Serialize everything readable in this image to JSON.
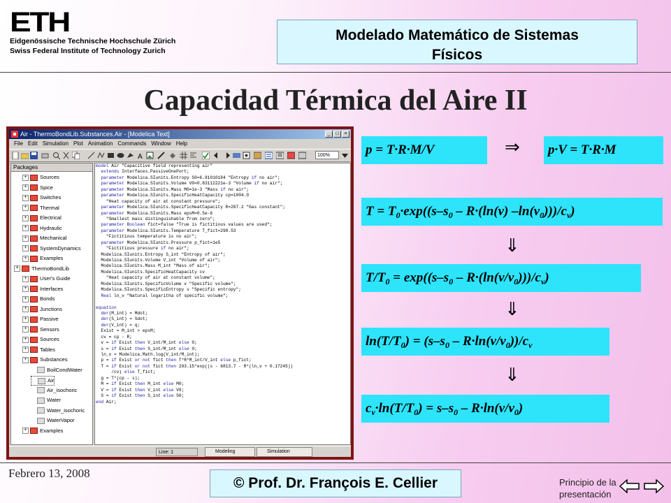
{
  "header": {
    "logo_text": "ETH",
    "institution_line1": "Eidgenössische Technische Hochschule Zürich",
    "institution_line2": "Swiss Federal Institute of Technology Zurich",
    "course_line1": "Modelado Matemático de Sistemas",
    "course_line2": "Físicos"
  },
  "slide_title": "Capacidad Térmica del Aire II",
  "app_window": {
    "title": "Air - ThermoBondLib.Substances.Air - [Modelica Text]",
    "menu": [
      "File",
      "Edit",
      "Simulation",
      "Plot",
      "Animation",
      "Commands",
      "Window",
      "Help"
    ],
    "zoom": "100%",
    "packages_header": "Packages",
    "tree": [
      {
        "label": "Sources",
        "level": 1
      },
      {
        "label": "Spice",
        "level": 1
      },
      {
        "label": "Switches",
        "level": 1
      },
      {
        "label": "Thermal",
        "level": 1
      },
      {
        "label": "Electrical",
        "level": 1
      },
      {
        "label": "Hydraulic",
        "level": 1
      },
      {
        "label": "Mechanical",
        "level": 1
      },
      {
        "label": "SystemDynamics",
        "level": 1
      },
      {
        "label": "Examples",
        "level": 1
      },
      {
        "label": "ThermoBondLib",
        "level": 0
      },
      {
        "label": "User's Guide",
        "level": 1
      },
      {
        "label": "Interfaces",
        "level": 1
      },
      {
        "label": "Bonds",
        "level": 1
      },
      {
        "label": "Junctions",
        "level": 1
      },
      {
        "label": "Passive",
        "level": 1
      },
      {
        "label": "Sensors",
        "level": 1
      },
      {
        "label": "Sources",
        "level": 1
      },
      {
        "label": "Tables",
        "level": 1
      },
      {
        "label": "Substances",
        "level": 1
      },
      {
        "label": "BoilCondWater",
        "level": 2
      },
      {
        "label": "Air",
        "level": 2,
        "selected": true
      },
      {
        "label": "Air_isochoric",
        "level": 2
      },
      {
        "label": "Water",
        "level": 2
      },
      {
        "label": "Water_isochoric",
        "level": 2
      },
      {
        "label": "WaterVapor",
        "level": 2
      },
      {
        "label": "Examples",
        "level": 1
      }
    ],
    "code_lines": [
      "model Air \"Capacitive field representing air\"",
      "  extends Interfaces.PassiveOnePort;",
      "  parameter Modelica.SIunits.Entropy S0=6.81010184 \"Entropy if no air\";",
      "  parameter Modelica.SIunits.Volume V0=0.83112221e-3 \"Volume if no air\";",
      "  parameter Modelica.SIunits.Mass M0=1e-3 \"Mass if no air\";",
      "  parameter Modelica.SIunits.SpecificHeatCapacity cp=1004.0",
      "    \"Heat capacity of air at constant pressure\";",
      "  parameter Modelica.SIunits.SpecificHeatCapacity R=287.2 \"Gas constant\";",
      "  parameter Modelica.SIunits.Mass epsM=0.5e-6",
      "    \"Smallest mass distinguishable from zero\";",
      "  parameter Boolean fict=false \"True is fictitious values are used\";",
      "  parameter Modelica.SIunits.Temperature T_fict=298.53",
      "    \"Fictitious temperature is no air\";",
      "  parameter Modelica.SIunits.Pressure p_fict=1e5",
      "    \"Fictitious pressure if no air\";",
      "  Modelica.SIunits.Entropy S_int \"Entropy of air\";",
      "  Modelica.SIunits.Volume V_int \"Volume of air\";",
      "  Modelica.SIunits.Mass M_int \"Mass of air\";",
      "  Modelica.SIunits.SpecificHeatCapacity cv",
      "    \"Heat capacity of air at constant volume\";",
      "  Modelica.SIunits.SpecificVolume v \"Specific volume\";",
      "  Modelica.SIunits.SpecificEntropy s \"Specific entropy\";",
      "  Real ln_v \"Natural logaritha of specific volume\";",
      "",
      "equation",
      "  der(M_int) = Mdot;",
      "  der(S_int) = Sdot;",
      "  der(V_int) = q;",
      "  Exist = M_int > epsM;",
      "  cv = cp - R;",
      "  v = if Exist then V_int/M_int else 0;",
      "  s = if Exist then S_int/M_int else 0;",
      "  ln_v = Modelica.Math.log(V_int/M_int);",
      "  p = if Exist or not fict then T*R*M_int/V_int else p_fict;",
      "  T = if Exist or not fict then 293.15*exp((s - 6813.7 - R*(ln_v + 0.17245))",
      "      /cv) else T_fict;",
      "  g = T*(cp - s);",
      "  M = if Exist then M_int else M0;",
      "  V = if Exist then V_int else V0;",
      "  S = if Exist then S_int else S0;",
      "end Air;"
    ],
    "status_line": "Line:  1",
    "tab_modeling": "Modeling",
    "tab_simulation": "Simulation"
  },
  "equations": {
    "eq1_left": "p = T·R·M/V",
    "implies": "⇒",
    "eq1_right": "p·V = T·R·M",
    "down_arrow": "⇓",
    "eq2": "T = T0·exp((s–s0 – R·(ln(v) –ln(v0)))/cv)",
    "eq3": "T/T0 = exp((s–s0 – R·(ln(v/v0)))/cv)",
    "eq4": "ln(T/T0) = (s–s0 – R·ln(v/v0))/cv",
    "eq5": "cv·ln(T/T0) = s–s0 – R·ln(v/v0)"
  },
  "footer": {
    "date": "Febrero 13, 2008",
    "author": "© Prof. Dr. François E. Cellier",
    "home_link": "Principio de la presentación"
  },
  "colors": {
    "equation_box": "#2de4fb",
    "header_box": "#d9f7ff",
    "frame": "#7f1414"
  }
}
